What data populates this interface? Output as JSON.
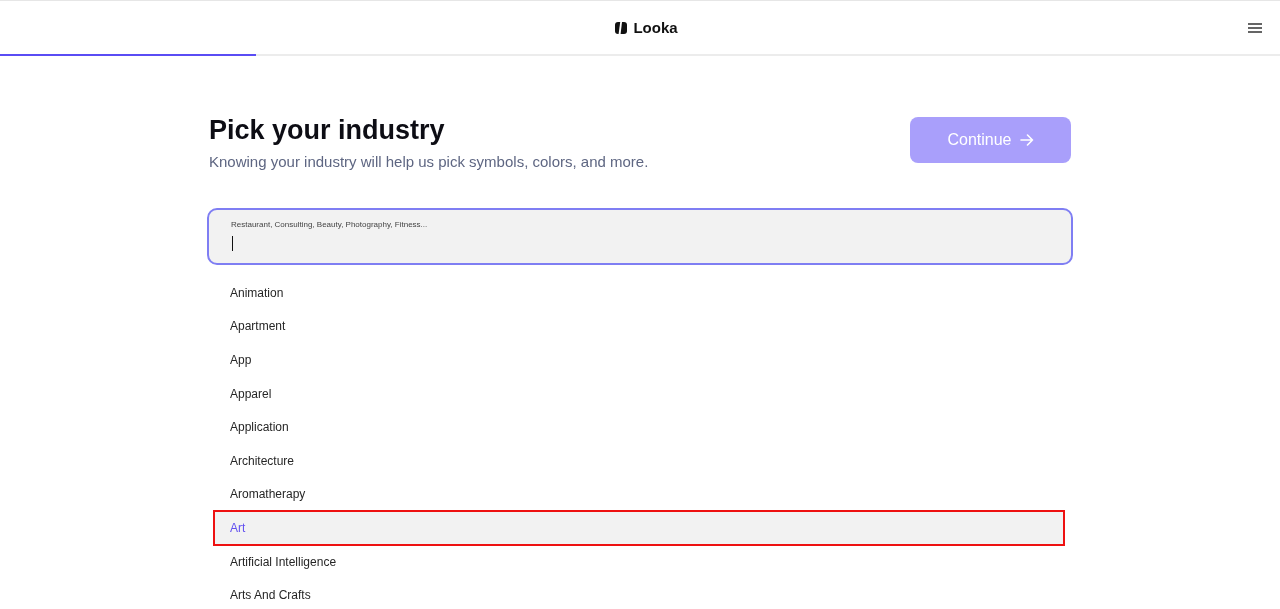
{
  "header": {
    "logo": "Looka",
    "progress": {
      "level": 0.2
    }
  },
  "heading": {
    "title": "Pick your industry",
    "subtitle": "Knowing your industry will help us pick symbols, colors, and more."
  },
  "continue_button": {
    "label": "Continue",
    "disabled": true
  },
  "search": {
    "placeholder": "Restaurant, Consulting, Beauty, Photography, Fitness...",
    "focused": true
  },
  "suggestions": [
    {
      "label": "Animation",
      "selected": false,
      "annotated": false
    },
    {
      "label": "Apartment",
      "selected": false,
      "annotated": false
    },
    {
      "label": "App",
      "selected": false,
      "annotated": false
    },
    {
      "label": "Apparel",
      "selected": false,
      "annotated": false
    },
    {
      "label": "Application",
      "selected": false,
      "annotated": false
    },
    {
      "label": "Architecture",
      "selected": false,
      "annotated": false
    },
    {
      "label": "Aromatherapy",
      "selected": false,
      "annotated": false
    },
    {
      "label": "Art",
      "selected": true,
      "annotated": true
    },
    {
      "label": "Artificial Intelligence",
      "selected": false,
      "annotated": false
    },
    {
      "label": "Arts And Crafts",
      "selected": false,
      "annotated": false
    }
  ]
}
